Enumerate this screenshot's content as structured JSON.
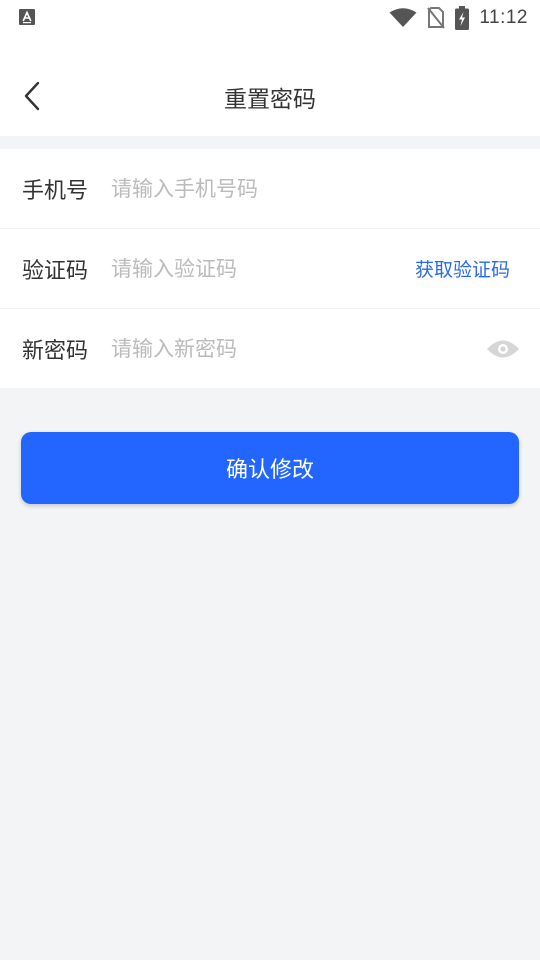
{
  "status_bar": {
    "time": "11:12",
    "left_icon": "a-box-icon",
    "icons": [
      "wifi-icon",
      "no-sim-icon",
      "battery-charging-icon"
    ]
  },
  "nav": {
    "title": "重置密码",
    "back_icon": "chevron-left-icon"
  },
  "form": {
    "phone": {
      "label": "手机号",
      "placeholder": "请输入手机号码",
      "value": ""
    },
    "code": {
      "label": "验证码",
      "placeholder": "请输入验证码",
      "value": "",
      "action_label": "获取验证码"
    },
    "password": {
      "label": "新密码",
      "placeholder": "请输入新密码",
      "value": "",
      "toggle_icon": "eye-icon"
    }
  },
  "submit": {
    "label": "确认修改"
  },
  "colors": {
    "accent": "#2266ff",
    "link": "#2a6ae9",
    "background": "#f3f4f6"
  }
}
